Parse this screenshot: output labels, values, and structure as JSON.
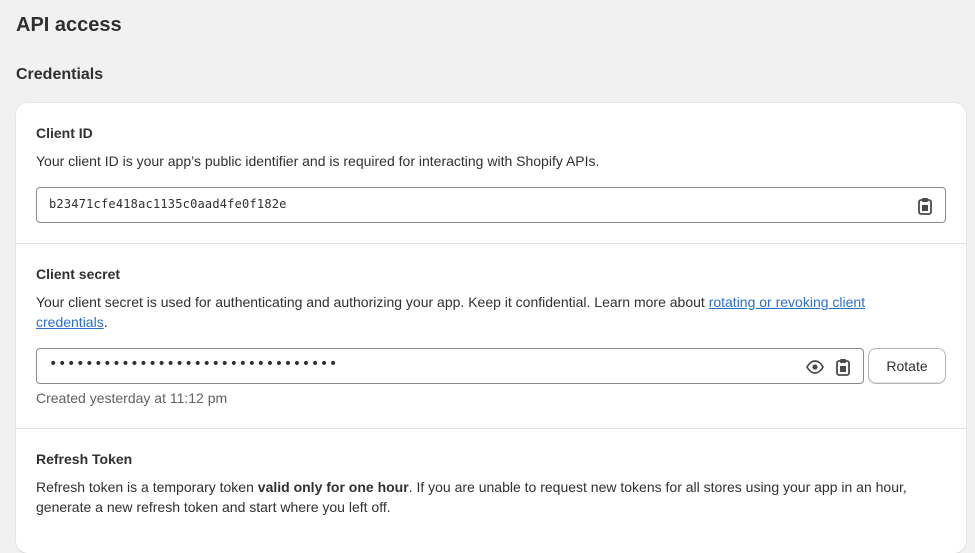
{
  "page": {
    "title": "API access"
  },
  "credentials": {
    "title": "Credentials",
    "client_id": {
      "label": "Client ID",
      "description": "Your client ID is your app’s public identifier and is required for interacting with Shopify APIs.",
      "value": "b23471cfe418ac1135c0aad4fe0f182e",
      "copy_icon": "clipboard-icon"
    },
    "client_secret": {
      "label": "Client secret",
      "description_before": "Your client secret is used for authenticating and authorizing your app. Keep it confidential. Learn more about ",
      "link_text": "rotating or revoking client credentials",
      "description_after": ".",
      "masked_value": "••••••••••••••••••••••••••••••••",
      "reveal_icon": "eye-icon",
      "copy_icon": "clipboard-icon",
      "rotate_label": "Rotate",
      "created_text": "Created yesterday at 11:12 pm"
    },
    "refresh_token": {
      "label": "Refresh Token",
      "description_before": "Refresh token is a temporary token ",
      "description_bold": "valid only for one hour",
      "description_after": ". If you are unable to request new tokens for all stores using your app in an hour, generate a new refresh token and start where you left off."
    }
  },
  "colors": {
    "background": "#f1f1f1",
    "card": "#ffffff",
    "link": "#2c6ecb",
    "border": "#8a8a8a",
    "muted": "#616161"
  }
}
